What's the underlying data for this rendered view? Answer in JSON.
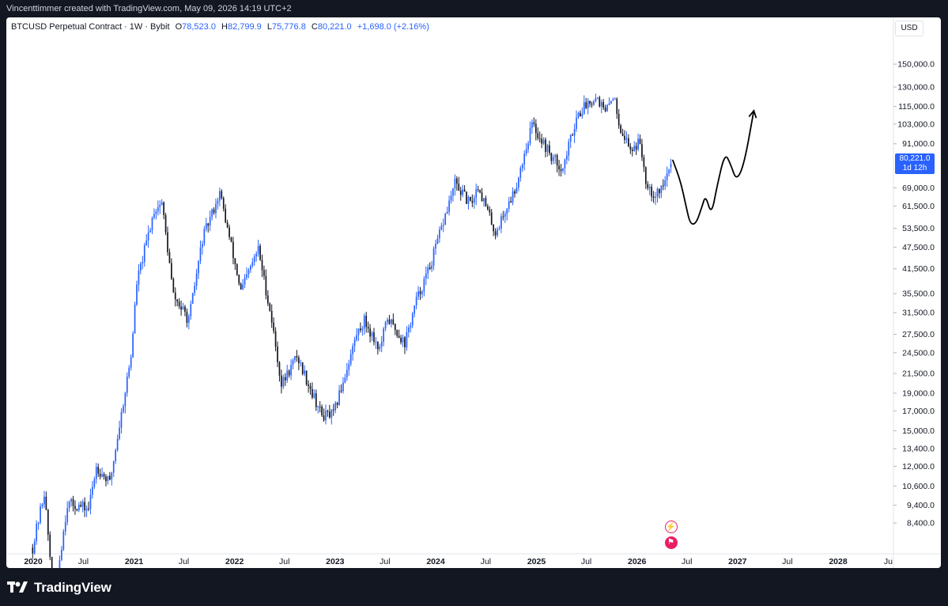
{
  "header": {
    "attribution": "Vincenttimmer created with TradingView.com, May 09, 2026 14:19 UTC+2"
  },
  "legend": {
    "symbol": "BTCUSD Perpetual Contract · 1W · Bybit",
    "o_label": "O",
    "o_value": "78,523.0",
    "h_label": "H",
    "h_value": "82,799.9",
    "l_label": "L",
    "l_value": "75,776.8",
    "c_label": "C",
    "c_value": "80,221.0",
    "change": "+1,698.0 (+2.16%)"
  },
  "currency": "USD",
  "last_price": {
    "value": "80,221.0",
    "countdown": "1d 12h"
  },
  "footer": {
    "brand": "TradingView"
  },
  "icons": [
    "lightning-event-icon",
    "us-flag-event-icon"
  ],
  "colors": {
    "up": "#2962ff",
    "down": "#131722",
    "label_bg": "#2962ff",
    "background": "#ffffff",
    "frame": "#131722"
  },
  "chart_data": {
    "type": "candlestick",
    "interval": "1W",
    "scale": "log",
    "y_ticks": [
      "150,000.0",
      "130,000.0",
      "115,000.0",
      "103,000.0",
      "91,000.0",
      "69,000.0",
      "61,500.0",
      "53,500.0",
      "47,500.0",
      "41,500.0",
      "35,500.0",
      "31,500.0",
      "27,500.0",
      "24,500.0",
      "21,500.0",
      "19,000.0",
      "17,000.0",
      "15,000.0",
      "13,400.0",
      "12,000.0",
      "10,600.0",
      "9,400.0",
      "8,400.0"
    ],
    "x_ticks": [
      "2020",
      "Jul",
      "2021",
      "Jul",
      "2022",
      "Jul",
      "2023",
      "Jul",
      "2024",
      "Jul",
      "2025",
      "Jul",
      "2026",
      "Jul",
      "2027",
      "Jul",
      "2028",
      "Ju"
    ],
    "bold_x_ticks": [
      "2020",
      "2021",
      "2022",
      "2023",
      "2024",
      "2025",
      "2026",
      "2027",
      "2028"
    ],
    "ylim": [
      7500,
      165000
    ],
    "price_path": [
      [
        "2019-12-30",
        7200
      ],
      [
        "2020-02-10",
        10200
      ],
      [
        "2020-03-16",
        5200
      ],
      [
        "2020-05-04",
        9500
      ],
      [
        "2020-07-20",
        9200
      ],
      [
        "2020-08-17",
        12000
      ],
      [
        "2020-10-05",
        10800
      ],
      [
        "2020-12-21",
        24000
      ],
      [
        "2021-01-11",
        38000
      ],
      [
        "2021-03-15",
        60000
      ],
      [
        "2021-04-12",
        63000
      ],
      [
        "2021-05-24",
        35000
      ],
      [
        "2021-07-19",
        30000
      ],
      [
        "2021-09-06",
        50000
      ],
      [
        "2021-11-08",
        67000
      ],
      [
        "2022-01-24",
        36000
      ],
      [
        "2022-03-28",
        47000
      ],
      [
        "2022-05-16",
        30000
      ],
      [
        "2022-06-20",
        20000
      ],
      [
        "2022-08-15",
        24000
      ],
      [
        "2022-11-14",
        16500
      ],
      [
        "2022-12-26",
        16600
      ],
      [
        "2023-03-20",
        27500
      ],
      [
        "2023-04-17",
        30000
      ],
      [
        "2023-06-12",
        25000
      ],
      [
        "2023-07-10",
        30500
      ],
      [
        "2023-09-11",
        26000
      ],
      [
        "2023-10-23",
        34000
      ],
      [
        "2023-12-11",
        42000
      ],
      [
        "2024-03-11",
        71000
      ],
      [
        "2024-05-06",
        62000
      ],
      [
        "2024-06-03",
        70000
      ],
      [
        "2024-08-05",
        52000
      ],
      [
        "2024-10-14",
        68000
      ],
      [
        "2024-12-16",
        103000
      ],
      [
        "2025-02-24",
        84000
      ],
      [
        "2025-04-07",
        78000
      ],
      [
        "2025-05-26",
        108000
      ],
      [
        "2025-07-14",
        120000
      ],
      [
        "2025-08-11",
        122000
      ],
      [
        "2025-09-08",
        110000
      ],
      [
        "2025-10-06",
        124000
      ],
      [
        "2025-11-03",
        100000
      ],
      [
        "2025-12-08",
        88000
      ],
      [
        "2026-01-12",
        92000
      ],
      [
        "2026-02-02",
        73000
      ],
      [
        "2026-03-02",
        66000
      ],
      [
        "2026-04-06",
        70000
      ],
      [
        "2026-05-04",
        80221
      ]
    ],
    "projection": [
      [
        "2026-05-11",
        82000
      ],
      [
        "2026-06-08",
        72000
      ],
      [
        "2026-06-29",
        61000
      ],
      [
        "2026-07-13",
        55000
      ],
      [
        "2026-08-03",
        55000
      ],
      [
        "2026-08-24",
        61000
      ],
      [
        "2026-09-07",
        66000
      ],
      [
        "2026-09-28",
        58000
      ],
      [
        "2026-10-19",
        70000
      ],
      [
        "2026-11-16",
        86000
      ],
      [
        "2026-12-07",
        80000
      ],
      [
        "2026-12-28",
        72000
      ],
      [
        "2027-01-25",
        80000
      ],
      [
        "2027-03-01",
        112000
      ]
    ]
  }
}
